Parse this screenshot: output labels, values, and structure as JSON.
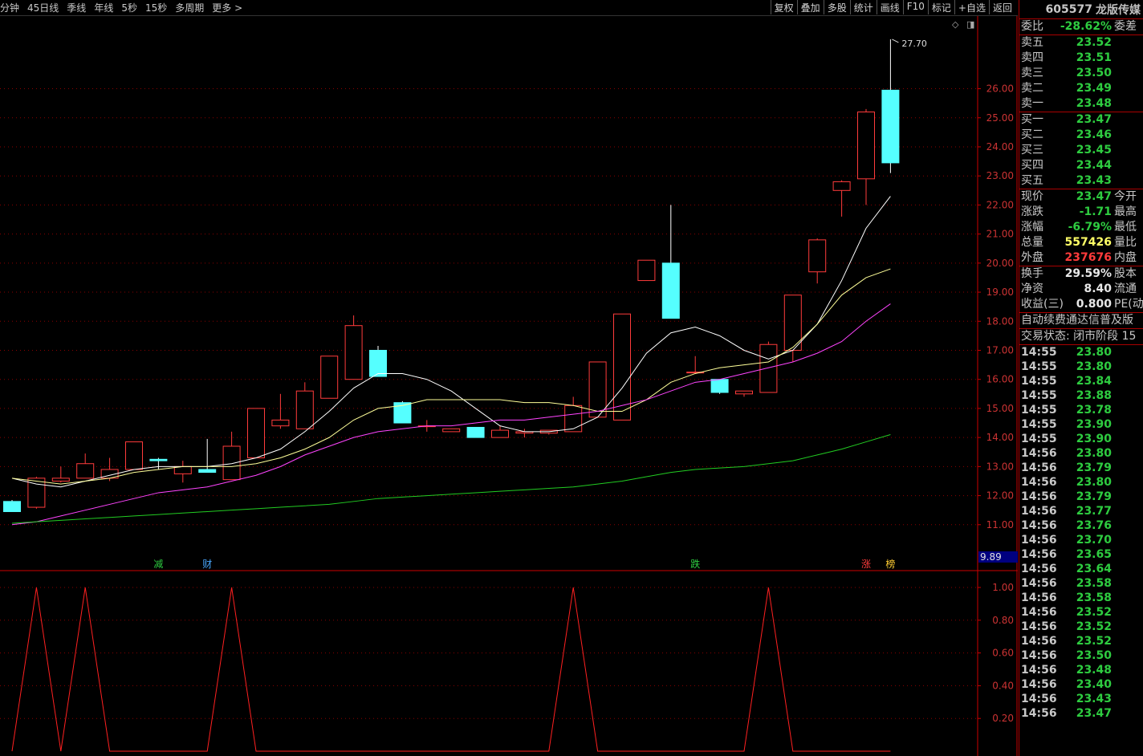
{
  "toolbar": {
    "left": [
      "分钟",
      "45日线",
      "季线",
      "年线",
      "5秒",
      "15秒",
      "多周期",
      "更多 >"
    ],
    "right": [
      "复权",
      "叠加",
      "多股",
      "统计",
      "画线",
      "F10",
      "标记",
      "+自选",
      "返回"
    ]
  },
  "stock": {
    "code": "605577",
    "name": "龙版传媒"
  },
  "weibi": {
    "label": "委比",
    "value": "-28.62%",
    "right_label": "委差"
  },
  "asks": [
    {
      "label": "卖五",
      "price": "23.52"
    },
    {
      "label": "卖四",
      "price": "23.51"
    },
    {
      "label": "卖三",
      "price": "23.50"
    },
    {
      "label": "卖二",
      "price": "23.49"
    },
    {
      "label": "卖一",
      "price": "23.48"
    }
  ],
  "bids": [
    {
      "label": "买一",
      "price": "23.47"
    },
    {
      "label": "买二",
      "price": "23.46"
    },
    {
      "label": "买三",
      "price": "23.45"
    },
    {
      "label": "买四",
      "price": "23.44"
    },
    {
      "label": "买五",
      "price": "23.43"
    }
  ],
  "quote": [
    {
      "label": "现价",
      "value": "23.47",
      "color": "green",
      "right": "今开"
    },
    {
      "label": "涨跌",
      "value": "-1.71",
      "color": "green",
      "right": "最高"
    },
    {
      "label": "涨幅",
      "value": "-6.79%",
      "color": "green",
      "right": "最低"
    },
    {
      "label": "总量",
      "value": "557426",
      "color": "yellow",
      "right": "量比"
    },
    {
      "label": "外盘",
      "value": "237676",
      "color": "red",
      "right": "内盘"
    }
  ],
  "fundamentals": [
    {
      "label": "换手",
      "value": "29.59%",
      "right": "股本"
    },
    {
      "label": "净资",
      "value": "8.40",
      "right": "流通"
    },
    {
      "label": "收益(三)",
      "value": "0.800",
      "right": "PE(动"
    }
  ],
  "notes": [
    "自动续费通达信普及版",
    "交易状态: 闭市阶段 15"
  ],
  "ticks": [
    {
      "time": "14:55",
      "price": "23.80"
    },
    {
      "time": "14:55",
      "price": "23.80"
    },
    {
      "time": "14:55",
      "price": "23.84"
    },
    {
      "time": "14:55",
      "price": "23.88"
    },
    {
      "time": "14:55",
      "price": "23.78"
    },
    {
      "time": "14:55",
      "price": "23.90"
    },
    {
      "time": "14:55",
      "price": "23.90"
    },
    {
      "time": "14:56",
      "price": "23.80"
    },
    {
      "time": "14:56",
      "price": "23.79"
    },
    {
      "time": "14:56",
      "price": "23.80"
    },
    {
      "time": "14:56",
      "price": "23.79"
    },
    {
      "time": "14:56",
      "price": "23.77"
    },
    {
      "time": "14:56",
      "price": "23.76"
    },
    {
      "time": "14:56",
      "price": "23.70"
    },
    {
      "time": "14:56",
      "price": "23.65"
    },
    {
      "time": "14:56",
      "price": "23.64"
    },
    {
      "time": "14:56",
      "price": "23.58"
    },
    {
      "time": "14:56",
      "price": "23.58"
    },
    {
      "time": "14:56",
      "price": "23.52"
    },
    {
      "time": "14:56",
      "price": "23.52"
    },
    {
      "time": "14:56",
      "price": "23.52"
    },
    {
      "time": "14:56",
      "price": "23.50"
    },
    {
      "time": "14:56",
      "price": "23.48"
    },
    {
      "time": "14:56",
      "price": "23.40"
    },
    {
      "time": "14:56",
      "price": "23.43"
    },
    {
      "time": "14:56",
      "price": "23.47"
    }
  ],
  "main_chart": {
    "y_ticks": [
      "26.00",
      "25.00",
      "24.00",
      "23.00",
      "22.00",
      "21.00",
      "20.00",
      "19.00",
      "18.00",
      "17.00",
      "16.00",
      "15.00",
      "14.00",
      "13.00",
      "12.00",
      "11.00"
    ],
    "y_tick_values": [
      26,
      25,
      24,
      23,
      22,
      21,
      20,
      19,
      18,
      17,
      16,
      15,
      14,
      13,
      12,
      11
    ],
    "y_range": [
      10.0,
      28.5
    ],
    "high_marker": "27.70",
    "low_marker": "9.89",
    "event_markers": [
      {
        "text": "减",
        "candle": 6,
        "color": "#2ecc40"
      },
      {
        "text": "财",
        "candle": 8,
        "color": "#4aa8ff"
      },
      {
        "text": "跌",
        "candle": 28,
        "color": "#2ecc40"
      },
      {
        "text": "涨",
        "candle": 35,
        "color": "#ff3b3b"
      },
      {
        "text": "榜",
        "candle": 36,
        "color": "#ffcc33"
      }
    ],
    "colors": {
      "up": "#ff3b3b",
      "down": "#55ffff",
      "ma1": "#ffffff",
      "ma2": "#ffff99",
      "ma3": "#ff44ff",
      "ma4": "#22cc22",
      "grid": "#8b0000",
      "axis": "#cc0000"
    }
  },
  "chart_data": {
    "type": "candlestick",
    "ohlc": [
      [
        11.8,
        11.85,
        11.45,
        11.45
      ],
      [
        11.6,
        12.65,
        11.55,
        12.6
      ],
      [
        12.5,
        13.0,
        12.45,
        12.6
      ],
      [
        12.6,
        13.45,
        12.6,
        13.1
      ],
      [
        12.6,
        13.3,
        12.5,
        12.9
      ],
      [
        12.9,
        13.85,
        12.9,
        13.85
      ],
      [
        13.25,
        13.3,
        12.9,
        13.2
      ],
      [
        12.75,
        13.2,
        12.45,
        13.0
      ],
      [
        12.9,
        13.95,
        12.9,
        12.8
      ],
      [
        12.55,
        14.2,
        12.55,
        13.7
      ],
      [
        13.3,
        15.0,
        13.3,
        15.0
      ],
      [
        14.4,
        15.5,
        14.3,
        14.6
      ],
      [
        14.3,
        15.9,
        14.3,
        15.6
      ],
      [
        15.35,
        16.8,
        15.35,
        16.8
      ],
      [
        16.0,
        18.2,
        16.0,
        17.85
      ],
      [
        17.0,
        17.15,
        16.1,
        16.1
      ],
      [
        15.2,
        15.25,
        14.5,
        14.5
      ],
      [
        14.4,
        14.6,
        14.2,
        14.4
      ],
      [
        14.2,
        14.3,
        14.2,
        14.3
      ],
      [
        14.35,
        14.35,
        14.0,
        14.0
      ],
      [
        14.0,
        14.4,
        14.0,
        14.25
      ],
      [
        14.15,
        14.3,
        14.0,
        14.2
      ],
      [
        14.15,
        14.25,
        14.1,
        14.25
      ],
      [
        14.2,
        15.4,
        14.2,
        15.1
      ],
      [
        14.7,
        16.6,
        14.7,
        16.6
      ],
      [
        14.6,
        18.25,
        14.6,
        18.25
      ],
      [
        19.4,
        20.1,
        19.4,
        20.1
      ],
      [
        20.0,
        22.0,
        18.1,
        18.1
      ],
      [
        16.25,
        16.8,
        16.2,
        16.25
      ],
      [
        16.0,
        16.0,
        15.5,
        15.55
      ],
      [
        15.5,
        15.6,
        15.4,
        15.6
      ],
      [
        15.55,
        17.3,
        15.55,
        17.2
      ],
      [
        17.0,
        18.9,
        16.6,
        18.9
      ],
      [
        19.7,
        20.85,
        19.3,
        20.8
      ],
      [
        22.5,
        22.85,
        21.6,
        22.8
      ],
      [
        22.9,
        25.3,
        22.0,
        25.2
      ],
      [
        25.95,
        27.7,
        23.1,
        23.45
      ]
    ],
    "ma_lines": [
      {
        "values": [
          12.6,
          12.4,
          12.3,
          12.5,
          12.7,
          12.9,
          13.0,
          13.0,
          13.0,
          13.1,
          13.3,
          13.6,
          14.2,
          14.9,
          15.7,
          16.2,
          16.2,
          16.0,
          15.6,
          15.0,
          14.4,
          14.2,
          14.2,
          14.3,
          14.7,
          15.7,
          16.9,
          17.6,
          17.8,
          17.5,
          17.0,
          16.7,
          17.0,
          17.9,
          19.4,
          21.2,
          22.3
        ]
      },
      {
        "values": [
          12.6,
          12.5,
          12.4,
          12.5,
          12.6,
          12.8,
          12.9,
          13.0,
          13.0,
          13.0,
          13.1,
          13.3,
          13.6,
          14.0,
          14.6,
          15.0,
          15.1,
          15.3,
          15.3,
          15.3,
          15.3,
          15.2,
          15.2,
          15.1,
          14.9,
          14.9,
          15.3,
          15.9,
          16.2,
          16.4,
          16.5,
          16.6,
          17.1,
          17.9,
          18.9,
          19.5,
          19.8
        ]
      },
      {
        "values": [
          11.0,
          11.1,
          11.3,
          11.5,
          11.7,
          11.9,
          12.1,
          12.2,
          12.3,
          12.5,
          12.7,
          13.0,
          13.4,
          13.7,
          14.0,
          14.2,
          14.3,
          14.4,
          14.4,
          14.5,
          14.6,
          14.6,
          14.7,
          14.8,
          14.9,
          15.1,
          15.3,
          15.6,
          15.9,
          16.0,
          16.2,
          16.4,
          16.6,
          16.9,
          17.3,
          18.0,
          18.6
        ]
      },
      {
        "values": [
          11.05,
          11.1,
          11.15,
          11.2,
          11.25,
          11.3,
          11.35,
          11.4,
          11.45,
          11.5,
          11.55,
          11.6,
          11.65,
          11.7,
          11.8,
          11.9,
          11.95,
          12.0,
          12.05,
          12.1,
          12.15,
          12.2,
          12.25,
          12.3,
          12.4,
          12.5,
          12.65,
          12.8,
          12.9,
          12.95,
          13.0,
          13.1,
          13.2,
          13.4,
          13.6,
          13.85,
          14.1
        ]
      }
    ],
    "signal": {
      "y_ticks": [
        "1.00",
        "0.80",
        "0.60",
        "0.40",
        "0.20"
      ],
      "y_tick_values": [
        1.0,
        0.8,
        0.6,
        0.4,
        0.2
      ],
      "y_range": [
        0,
        1.0
      ],
      "peaks_at_candle": [
        1,
        3,
        9,
        23,
        31
      ]
    }
  }
}
